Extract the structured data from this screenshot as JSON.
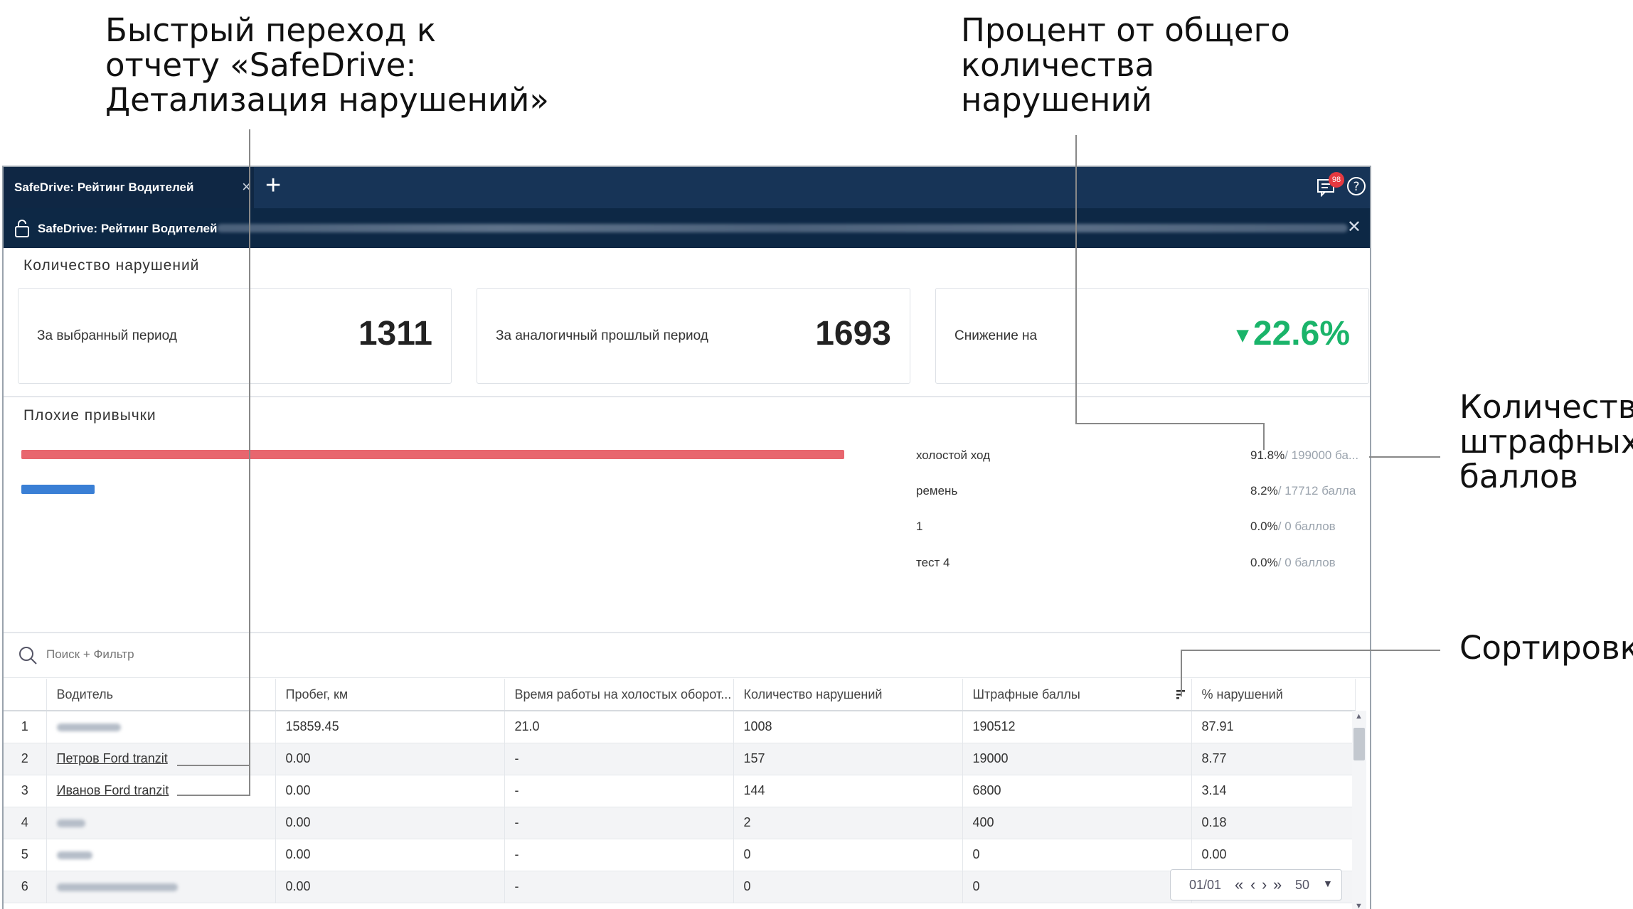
{
  "callouts": {
    "quick_nav": "Быстрый переход к\nотчету «SafeDrive:\nДетализация нарушений»",
    "percent": "Процент от общего\nколичества\nнарушений",
    "penalty": "Количество\nштрафных\nбаллов",
    "sort": "Сортировка"
  },
  "tab": {
    "title": "SafeDrive: Рейтинг Водителей",
    "close": "×",
    "add": "+"
  },
  "header": {
    "badge": "98"
  },
  "subheader": {
    "title": "SafeDrive: Рейтинг Водителей",
    "close": "✕"
  },
  "violations": {
    "section_title": "Количество нарушений",
    "cards": [
      {
        "label": "За выбранный период",
        "value": "1311"
      },
      {
        "label": "За аналогичный прошлый период",
        "value": "1693"
      },
      {
        "label": "Снижение на",
        "value": "22.6%",
        "arrow": "▼"
      }
    ]
  },
  "habits": {
    "section_title": "Плохие привычки",
    "bars": [
      {
        "fraction": 0.918,
        "color": "#e8666e"
      },
      {
        "fraction": 0.082,
        "color": "#3a7fd5"
      }
    ],
    "items": [
      {
        "name": "холостой ход",
        "pct": "91.8%",
        "points": "/ 199000 ба..."
      },
      {
        "name": "ремень",
        "pct": "8.2%",
        "points": "/ 17712 балла"
      },
      {
        "name": "1",
        "pct": "0.0%",
        "points": "/ 0 баллов"
      },
      {
        "name": "тест 4",
        "pct": "0.0%",
        "points": "/ 0 баллов"
      }
    ]
  },
  "search": {
    "placeholder": "Поиск + Фильтр"
  },
  "table": {
    "columns": [
      "Водитель",
      "Пробег, км",
      "Время работы на холостых оборот...",
      "Количество нарушений",
      "Штрафные баллы",
      "% нарушений"
    ],
    "rows": [
      {
        "n": "1",
        "driver": "",
        "mileage": "15859.45",
        "idle": "21.0",
        "count": "1008",
        "points": "190512",
        "pct": "87.91"
      },
      {
        "n": "2",
        "driver": "Петров Ford tranzit",
        "mileage": "0.00",
        "idle": "-",
        "count": "157",
        "points": "19000",
        "pct": "8.77"
      },
      {
        "n": "3",
        "driver": "Иванов Ford tranzit",
        "mileage": "0.00",
        "idle": "-",
        "count": "144",
        "points": "6800",
        "pct": "3.14"
      },
      {
        "n": "4",
        "driver": "",
        "mileage": "0.00",
        "idle": "-",
        "count": "2",
        "points": "400",
        "pct": "0.18"
      },
      {
        "n": "5",
        "driver": "",
        "mileage": "0.00",
        "idle": "-",
        "count": "0",
        "points": "0",
        "pct": "0.00"
      },
      {
        "n": "6",
        "driver": "",
        "mileage": "0.00",
        "idle": "-",
        "count": "0",
        "points": "0",
        "pct": ""
      }
    ]
  },
  "pager": {
    "page": "01/01",
    "size": "50"
  }
}
